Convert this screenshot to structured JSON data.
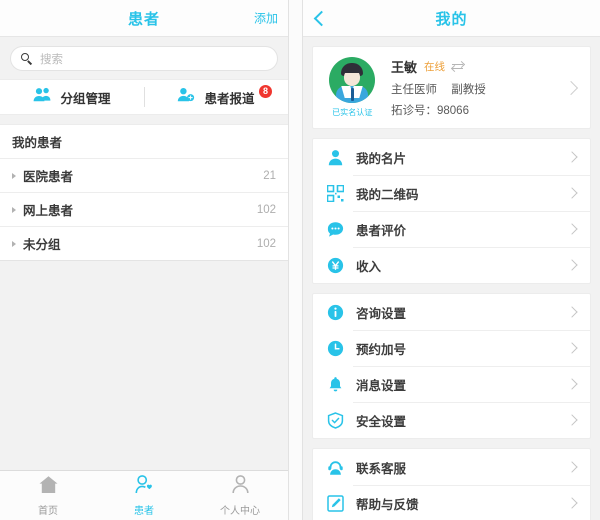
{
  "left": {
    "navbar": {
      "title": "患者",
      "action_label": "添加"
    },
    "search": {
      "placeholder": "搜索",
      "value": "",
      "icon": "search-icon"
    },
    "quick_actions": [
      {
        "label": "分组管理",
        "icon": "group-manage-icon",
        "badge": ""
      },
      {
        "label": "患者报道",
        "icon": "patient-report-icon",
        "badge": "8"
      }
    ],
    "list": {
      "header": "我的患者",
      "groups": [
        {
          "name": "医院患者",
          "count": "21"
        },
        {
          "name": "网上患者",
          "count": "102"
        },
        {
          "name": "未分组",
          "count": "102"
        }
      ]
    },
    "tabbar": [
      {
        "label": "首页",
        "icon": "home-icon",
        "active": false
      },
      {
        "label": "患者",
        "icon": "patient-heart-icon",
        "active": true
      },
      {
        "label": "个人中心",
        "icon": "person-icon",
        "active": false
      }
    ]
  },
  "right": {
    "navbar": {
      "title": "我的",
      "back_icon": "chevron-left-icon"
    },
    "profile": {
      "avatar_icon": "doctor-avatar",
      "verify_label": "已实名认证",
      "name": "王敏",
      "status": "在线",
      "status_toggle_icon": "swap-icon",
      "title_primary": "主任医师",
      "title_secondary": "副教授",
      "id_label": "拓诊号：98066",
      "chevron_icon": "chevron-right-icon"
    },
    "menu_groups": [
      {
        "items": [
          {
            "label": "我的名片",
            "icon": "person-card-icon"
          },
          {
            "label": "我的二维码",
            "icon": "qr-code-icon"
          },
          {
            "label": "患者评价",
            "icon": "chat-bubble-icon"
          },
          {
            "label": "收入",
            "icon": "yen-coin-icon"
          }
        ]
      },
      {
        "items": [
          {
            "label": "咨询设置",
            "icon": "info-icon"
          },
          {
            "label": "预约加号",
            "icon": "clock-icon"
          },
          {
            "label": "消息设置",
            "icon": "bell-icon"
          },
          {
            "label": "安全设置",
            "icon": "shield-icon"
          }
        ]
      },
      {
        "items": [
          {
            "label": "联系客服",
            "icon": "headset-support-icon"
          },
          {
            "label": "帮助与反馈",
            "icon": "pencil-edit-icon"
          }
        ]
      }
    ]
  },
  "colors": {
    "accent": "#29c3e8",
    "badge": "#f0362f",
    "status": "#eda03a",
    "avatar_bg": "#2bab63",
    "page_bg": "#f2f2f2"
  }
}
